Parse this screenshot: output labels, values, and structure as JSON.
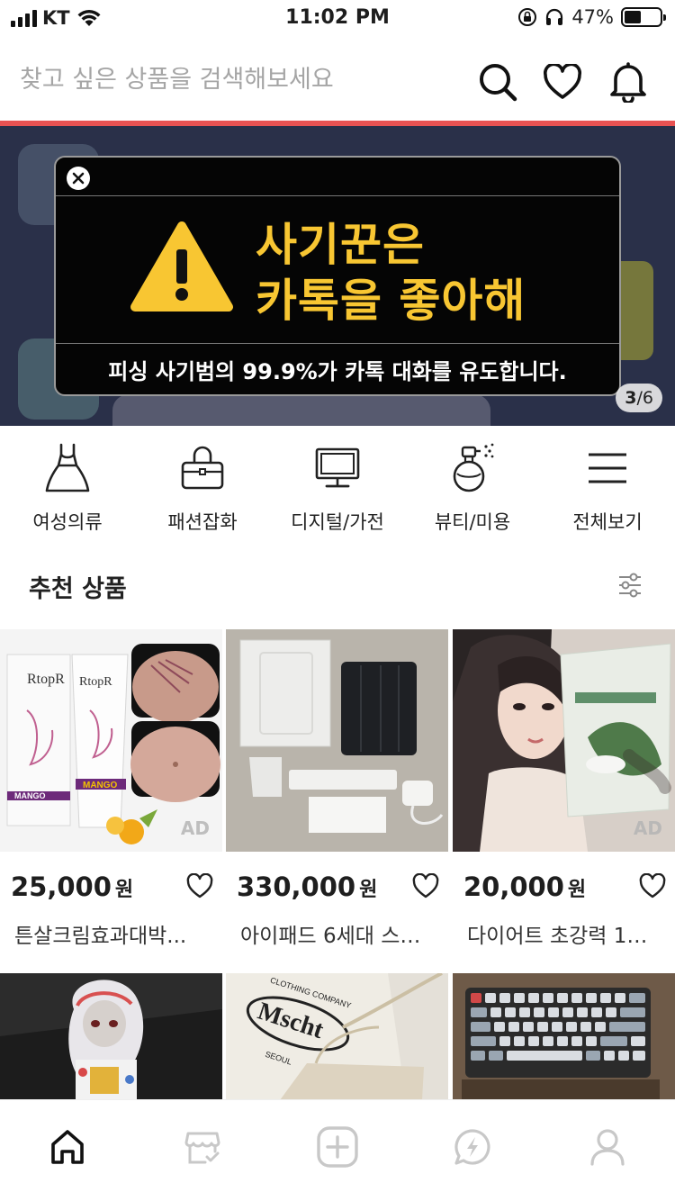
{
  "status_bar": {
    "carrier": "KT",
    "time": "11:02 PM",
    "battery_percent": "47%",
    "battery_level": 0.47
  },
  "search": {
    "placeholder": "찾고 싶은 상품을 검색해보세요"
  },
  "header_icons": [
    "search-icon",
    "heart-icon",
    "bell-icon"
  ],
  "banner": {
    "alert_title_line1": "사기꾼은",
    "alert_title_line2": "카톡을 좋아해",
    "alert_sub": "피싱 사기범의 99.9%가 카톡 대화를 유도합니다.",
    "page_current": "3",
    "page_total": "/6",
    "colors": {
      "title": "#f8c632",
      "background": "#2a3049"
    }
  },
  "categories": [
    {
      "label": "여성의류",
      "icon": "dress-icon"
    },
    {
      "label": "패션잡화",
      "icon": "handbag-icon"
    },
    {
      "label": "디지털/가전",
      "icon": "monitor-icon"
    },
    {
      "label": "뷰티/미용",
      "icon": "perfume-icon"
    },
    {
      "label": "전체보기",
      "icon": "menu-icon"
    }
  ],
  "section": {
    "title": "추천 상품"
  },
  "products": [
    {
      "price": "25,000",
      "unit": "원",
      "name": "튼살크림효과대박...",
      "ad": "AD"
    },
    {
      "price": "330,000",
      "unit": "원",
      "name": "아이패드 6세대 스…",
      "ad": ""
    },
    {
      "price": "20,000",
      "unit": "원",
      "name": "다이어트 초강력 1…",
      "ad": "AD"
    },
    {
      "price": "",
      "unit": "",
      "name": "",
      "ad": ""
    },
    {
      "price": "",
      "unit": "",
      "name": "",
      "ad": ""
    },
    {
      "price": "",
      "unit": "",
      "name": "",
      "ad": ""
    }
  ],
  "product_images": {
    "cream_brand": "RtopR",
    "cream_flavor": "MANGO",
    "bag_brand": "Mscht",
    "bag_text": "CLOTHING COMPANY",
    "bag_city": "SEOUL"
  },
  "bottom_nav": [
    "home-icon",
    "shop-icon",
    "add-icon",
    "chat-icon",
    "profile-icon"
  ],
  "accent": "#e85252"
}
